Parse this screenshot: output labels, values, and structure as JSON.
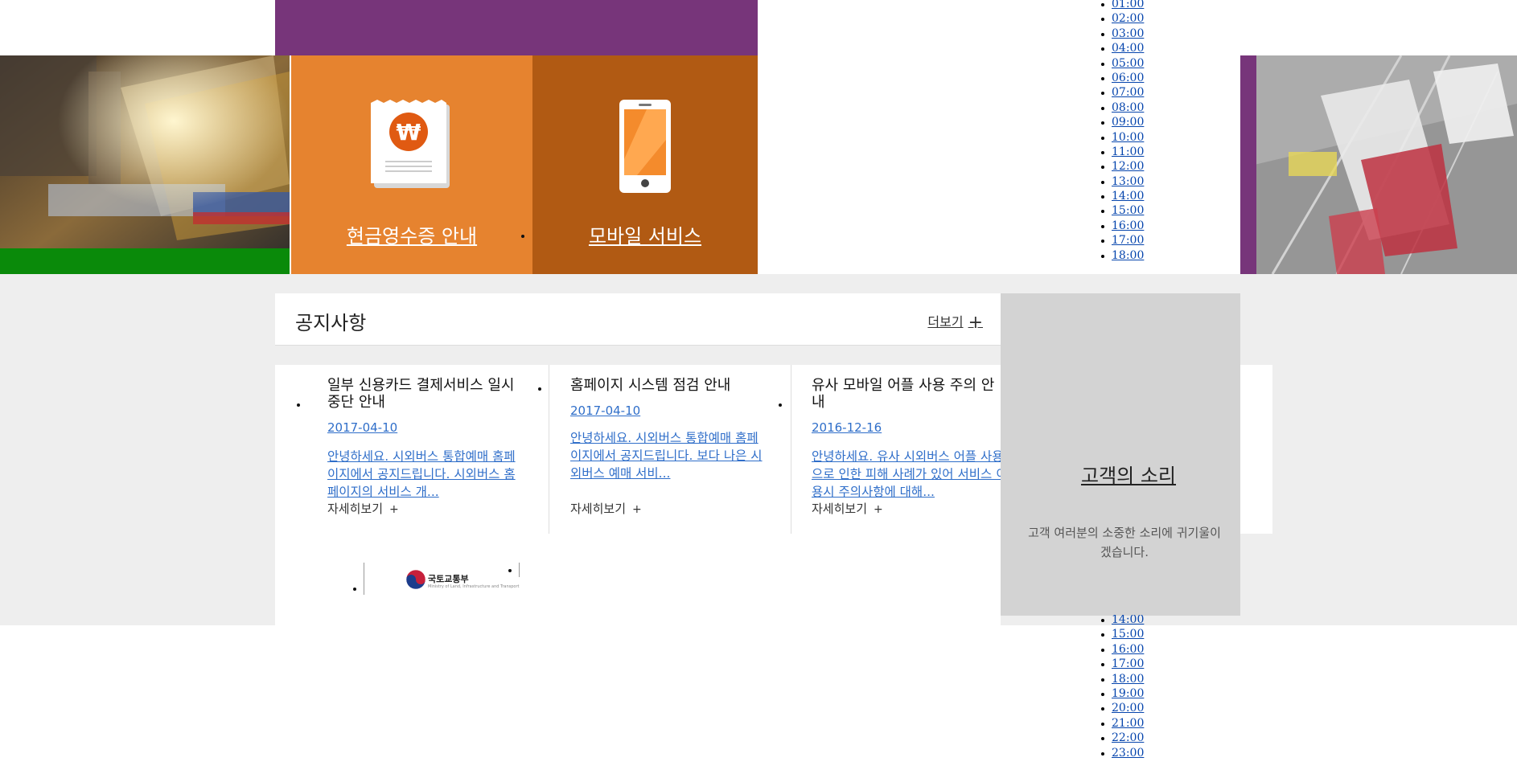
{
  "quick_menu": {
    "receipt_label": "현금영수증 안내",
    "mobile_label": "모바일 서비스",
    "won_symbol": "₩"
  },
  "times_top": [
    "01:00",
    "02:00",
    "03:00",
    "04:00",
    "05:00",
    "06:00",
    "07:00",
    "08:00",
    "09:00",
    "10:00",
    "11:00",
    "12:00",
    "13:00",
    "14:00",
    "15:00",
    "16:00",
    "17:00",
    "18:00"
  ],
  "times_bottom": [
    "14:00",
    "15:00",
    "16:00",
    "17:00",
    "18:00",
    "19:00",
    "20:00",
    "21:00",
    "22:00",
    "23:00"
  ],
  "notice": {
    "title": "공지사항",
    "more_label": "더보기",
    "more_plus": "+",
    "items": [
      {
        "title": "일부 신용카드 결제서비스 일시중단 안내",
        "date": "2017-04-10",
        "desc": "안녕하세요. 시외버스 통합예매 홈페이지에서 공지드립니다. 시외버스 홈페이지의 서비스 개...",
        "detail": "자세히보기",
        "detail_plus": "+"
      },
      {
        "title": "홈페이지 시스템 점검 안내",
        "date": "2017-04-10",
        "desc": "안녕하세요. 시외버스 통합예매 홈페이지에서 공지드립니다. 보다 나은 시외버스 예매 서비...",
        "detail": "자세히보기",
        "detail_plus": "+"
      },
      {
        "title": "유사 모바일 어플 사용 주의 안내",
        "date": "2016-12-16",
        "desc": "안녕하세요. 유사 시외버스 어플 사용으로 인한 피해 사례가 있어 서비스 이용시 주의사항에 대해...",
        "detail": "자세히보기",
        "detail_plus": "+"
      }
    ]
  },
  "voice": {
    "title": "고객의 소리",
    "desc": "고객 여러분의 소중한 소리에 귀기울이겠습니다."
  },
  "footer": {
    "ministry_name": "국토교통부",
    "ministry_sub": "Ministry of Land, Infrastructure and Transport"
  },
  "colors": {
    "purple": "#77357a",
    "orange": "#e6832f",
    "dark_orange": "#b15a13",
    "link_blue": "#2f6ec9",
    "voice_gray": "#d3d3d3"
  },
  "icons": [
    "receipt-won-icon",
    "smartphone-icon",
    "plus-icon",
    "ministry-logo-icon"
  ]
}
